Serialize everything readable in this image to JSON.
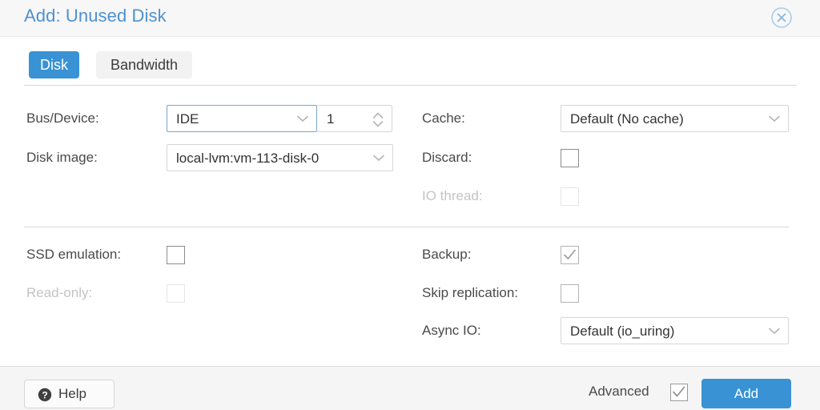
{
  "dialog": {
    "title": "Add: Unused Disk",
    "close_icon": "close-circle-icon"
  },
  "tabs": [
    {
      "label": "Disk",
      "active": true
    },
    {
      "label": "Bandwidth",
      "active": false
    }
  ],
  "form": {
    "left_column": [
      {
        "label": "Bus/Device:",
        "type": "combo-with-spinner",
        "value": "IDE",
        "spinner_value": "1",
        "focused": true,
        "disabled": false
      },
      {
        "label": "Disk image:",
        "type": "combo",
        "value": "local-lvm:vm-113-disk-0",
        "focused": false,
        "disabled": false
      },
      {
        "label": "SSD emulation:",
        "type": "checkbox",
        "checked": false,
        "disabled": false
      },
      {
        "label": "Read-only:",
        "type": "checkbox",
        "checked": false,
        "disabled": true
      }
    ],
    "right_column": [
      {
        "label": "Cache:",
        "type": "combo",
        "value": "Default (No cache)",
        "focused": false,
        "disabled": false
      },
      {
        "label": "Discard:",
        "type": "checkbox",
        "checked": false,
        "disabled": false
      },
      {
        "label": "IO thread:",
        "type": "checkbox",
        "checked": false,
        "disabled": true
      },
      {
        "label": "Backup:",
        "type": "checkbox",
        "checked": true,
        "disabled": false
      },
      {
        "label": "Skip replication:",
        "type": "checkbox",
        "checked": false,
        "disabled": false
      },
      {
        "label": "Async IO:",
        "type": "combo",
        "value": "Default (io_uring)",
        "focused": false,
        "disabled": false
      }
    ]
  },
  "footer": {
    "help_label": "Help",
    "help_icon": "question-mark-circle-icon",
    "advanced_label": "Advanced",
    "advanced_checked": true,
    "add_label": "Add"
  },
  "colors": {
    "accent": "#3892d4",
    "title": "#4e91d0",
    "header_bg": "#f7f7f7",
    "footer_bg": "#f5f5f5",
    "tab_inactive_bg": "#f2f2f2",
    "label": "#4a4a4a",
    "label_disabled": "#c4c4c4",
    "border": "#d6d6d6"
  }
}
